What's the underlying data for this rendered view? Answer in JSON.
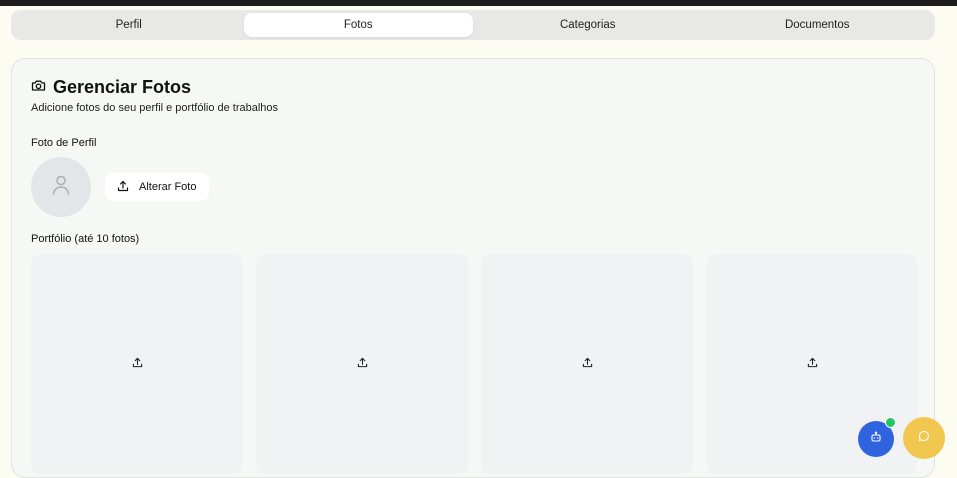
{
  "tabs": [
    {
      "label": "Perfil",
      "active": false
    },
    {
      "label": "Fotos",
      "active": true
    },
    {
      "label": "Categorias",
      "active": false
    },
    {
      "label": "Documentos",
      "active": false
    }
  ],
  "section": {
    "icon": "camera-icon",
    "title": "Gerenciar Fotos",
    "subtitle": "Adicione fotos do seu perfil e portfólio de trabalhos"
  },
  "profile_photo": {
    "label": "Foto de Perfil",
    "avatar_icon": "user-icon",
    "button_label": "Alterar Foto",
    "button_icon": "upload-icon"
  },
  "portfolio": {
    "label": "Portfólio (até 10 fotos)",
    "tiles": [
      {
        "icon": "upload-icon"
      },
      {
        "icon": "upload-icon"
      },
      {
        "icon": "upload-icon"
      },
      {
        "icon": "upload-icon"
      }
    ]
  },
  "floating_buttons": [
    {
      "name": "assistant-bot",
      "icon": "bot-icon",
      "color": "#2f63e0",
      "status": "online"
    },
    {
      "name": "chat",
      "icon": "chat-bubble-icon",
      "color": "#f2c74f"
    }
  ],
  "colors": {
    "background": "#fdfcf3",
    "card": "#f6f8f6",
    "status_online": "#22c55e"
  }
}
